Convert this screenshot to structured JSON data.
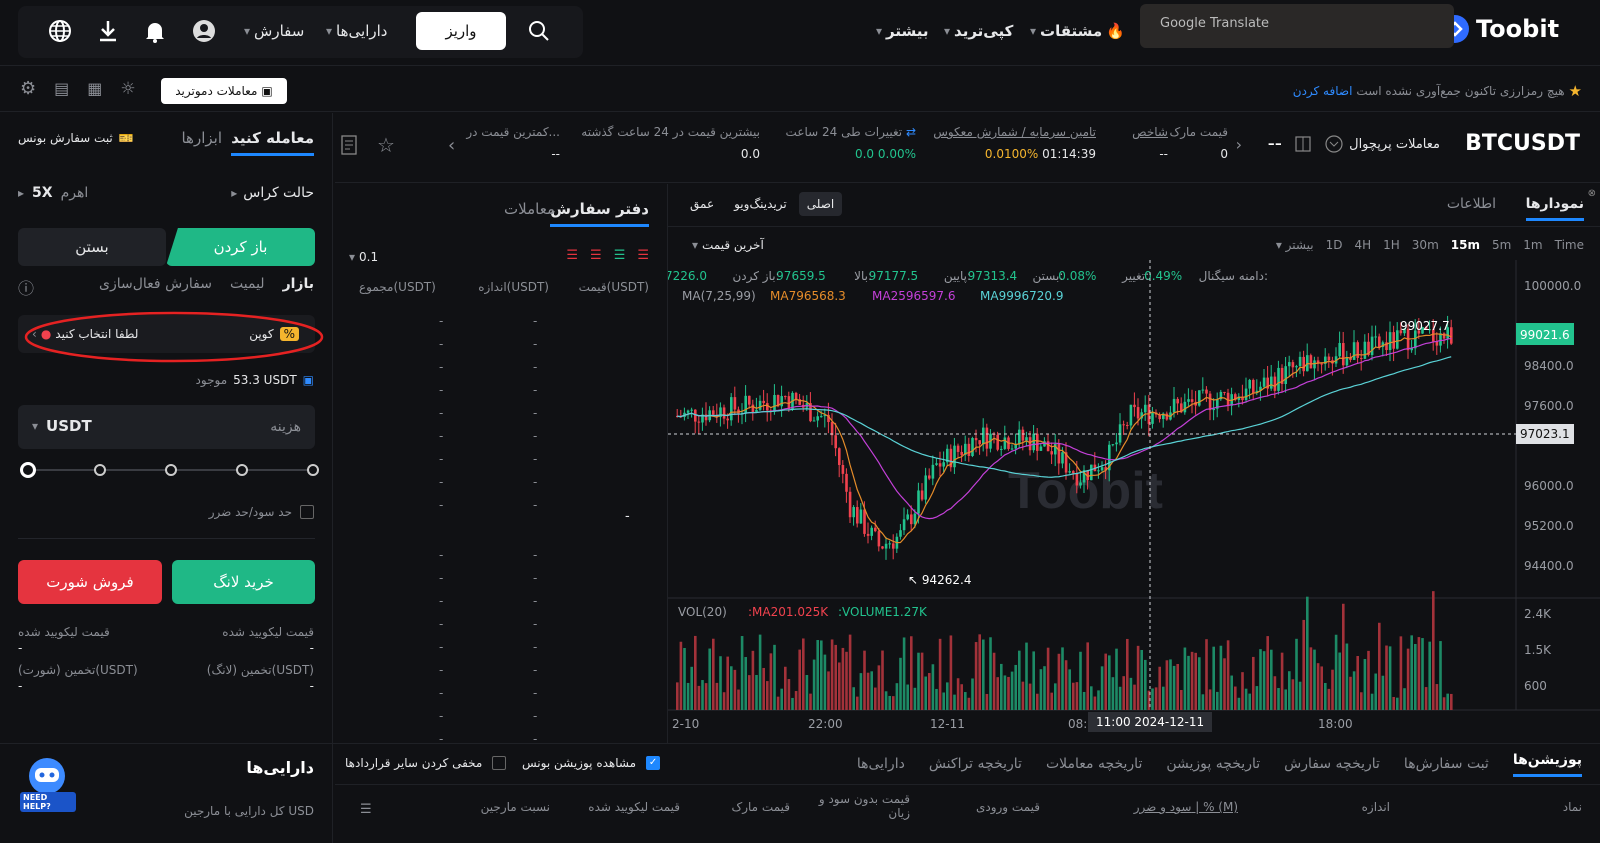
{
  "topnav": {
    "logo": "Toobit",
    "more": "بیشتر",
    "copy": "کپی‌ترید",
    "derivatives": "مشتقات",
    "deposit": "واریز",
    "assets": "دارایی‌ها",
    "order": "سفارش",
    "gtranslate": "Google Translate"
  },
  "banner": {
    "text": "هیچ رمزارزی تاکنون جمع‌آوری نشده است",
    "link": "اضافه کردن",
    "demo": "معاملات دموترید"
  },
  "ticker": {
    "symbol": "BTCUSDT",
    "type": "معاملات پرپچوال",
    "mark_label": "قیمت مارک",
    "mark": "0",
    "index_label": "شاخص",
    "index": "--",
    "funding_label": "تامین سرمایه / شمارش معکوس",
    "funding_time": "01:14:39",
    "funding_rate": "0.0100%",
    "change_label": "تغییرات طی 24 ساعت",
    "change": "0.0 0.00%",
    "high_label": "بیشترین قیمت در 24 ساعت گذشته",
    "high": "0.0",
    "low_label": "کمترین قیمت در...",
    "low": "--",
    "dash": "--"
  },
  "left": {
    "trade_tab": "معامله کنید",
    "tools_tab": "ابزارها",
    "bonus": "ثبت سفارش بونس",
    "margin_mode": "حالت کراس",
    "leverage_label": "اهرم",
    "leverage": "5X",
    "open": "باز کردن",
    "close": "بستن",
    "market": "بازار",
    "limit": "لیمیت",
    "conditional": "سفارش فعال‌سازی",
    "coupon": "کوپن",
    "coupon_select": "لطفا انتخاب کنید",
    "balance_label": "موجود",
    "balance": "53.3 USDT",
    "cost_label": "هزینه",
    "cost_unit": "USDT",
    "tpsl": "حد سود/حد ضرر",
    "long": "خرید لانگ",
    "short": "فروش شورت",
    "liq_label": "قیمت لیکویید شده",
    "liq_val": "-",
    "est_long": "تخمین (لانگ)(USDT)",
    "est_short": "تخمین (شورت)(USDT)"
  },
  "book": {
    "tab_book": "دفتر سفارش",
    "tab_trades": "معاملات",
    "precision": "0.1",
    "col_price": "قیمت(USDT)",
    "col_size": "اندازه(USDT)",
    "col_total": "مجموع(USDT)",
    "empty": "-"
  },
  "chart": {
    "tab_charts": "نمودارها",
    "tab_info": "اطلاعات",
    "view_main": "اصلی",
    "view_tv": "تریدینگ‌ویو",
    "view_depth": "عمق",
    "price_type": "آخرین قیمت",
    "more": "بیشتر",
    "timeframes": [
      "Time",
      "1m",
      "5m",
      "15m",
      "30m",
      "1H",
      "4H",
      "1D"
    ],
    "selected_tf": "15m",
    "ohlc": {
      "open_label": "باز کردن:",
      "open": "97226.0",
      "high_label": "بالا:",
      "high": "97659.5",
      "low_label": "پایین:",
      "low": "97177.5",
      "close_label": "بستن:",
      "close": "97313.4",
      "change_label": "تغییر:",
      "change": "0.08%",
      "amp_label": "دامنه سیگنال:",
      "amp": "0.49%"
    },
    "ma": {
      "label": "MA(7,25,99)",
      "ma7": "MA796568.3",
      "ma25": "MA2596597.6",
      "ma99": "MA9996720.9",
      "c7": "#e58c2a",
      "c25": "#c340d8",
      "c99": "#5ad2d6"
    },
    "price_axis": [
      "100000.0",
      "98400.0",
      "97600.0",
      "96000.0",
      "95200.0",
      "94400.0"
    ],
    "last_price": "99021.6",
    "cross_price": "97023.1",
    "hi_mark": "99027.7",
    "lo_mark": "94262.4",
    "vol": {
      "label": "VOL(20)",
      "ma": "MA201.025K",
      "volume": "VOLUME1.27K",
      "axis": [
        "2.4K",
        "1.5K",
        "600"
      ]
    },
    "time_axis": [
      "2-10",
      "22:00",
      "12-11",
      "08:00",
      "18:00"
    ],
    "cross_time": "11:00 2024-12-11"
  },
  "bottom": {
    "assets_title": "دارایی‌ها",
    "margin": "کل دارایی با مارجین USD",
    "tabs": [
      "پوزیشن‌ها",
      "ثبت سفارش‌ها",
      "تاریخچه سفارش",
      "تاریخچه پوزیشن",
      "تاریخچه معاملات",
      "تاریخچه تراکنش",
      "دارایی‌ها"
    ],
    "show_bonus": "مشاهده پوزیشن بونس",
    "hide_others": "مخفی کردن سایر قراردادها",
    "cols": [
      "نماد",
      "اندازه",
      "سود و ضرر | % (M)",
      "قیمت ورودی",
      "قیمت بدون سود و زیان",
      "قیمت مارک",
      "قیمت لیکویید شده",
      "نسبت مارجین"
    ],
    "help": "NEED HELP?"
  }
}
